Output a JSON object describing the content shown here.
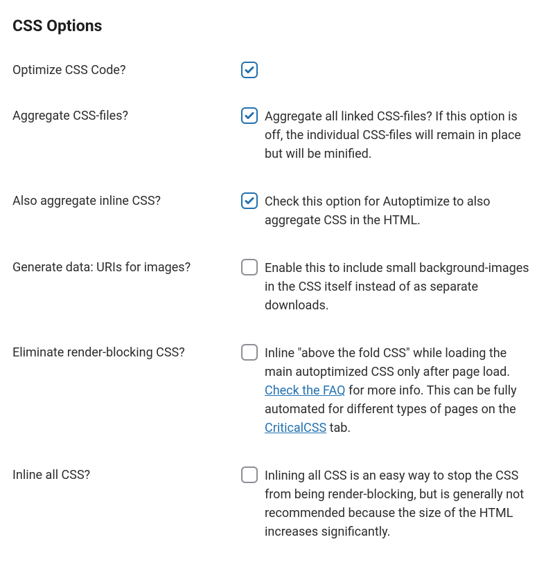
{
  "heading": "CSS Options",
  "rows": {
    "optimize": {
      "label": "Optimize CSS Code?",
      "checked": true,
      "desc": ""
    },
    "aggregate": {
      "label": "Aggregate CSS-files?",
      "checked": true,
      "desc": "Aggregate all linked CSS-files? If this option is off, the individual CSS-files will remain in place but will be minified."
    },
    "inline_agg": {
      "label": "Also aggregate inline CSS?",
      "checked": true,
      "desc": "Check this option for Autoptimize to also aggregate CSS in the HTML."
    },
    "datauri": {
      "label": "Generate data: URIs for images?",
      "checked": false,
      "desc": "Enable this to include small background-images in the CSS itself instead of as separate downloads."
    },
    "render_blocking": {
      "label": "Eliminate render-blocking CSS?",
      "checked": false,
      "desc_part1": "Inline \"above the fold CSS\" while loading the main autoptimized CSS only after page load. ",
      "link1": "Check the FAQ",
      "desc_part2": " for more info. This can be fully automated for different types of pages on the ",
      "link2": "CriticalCSS",
      "desc_part3": " tab."
    },
    "inline_all": {
      "label": "Inline all CSS?",
      "checked": false,
      "desc": "Inlining all CSS is an easy way to stop the CSS from being render-blocking, but is generally not recommended because the size of the HTML increases significantly."
    }
  }
}
